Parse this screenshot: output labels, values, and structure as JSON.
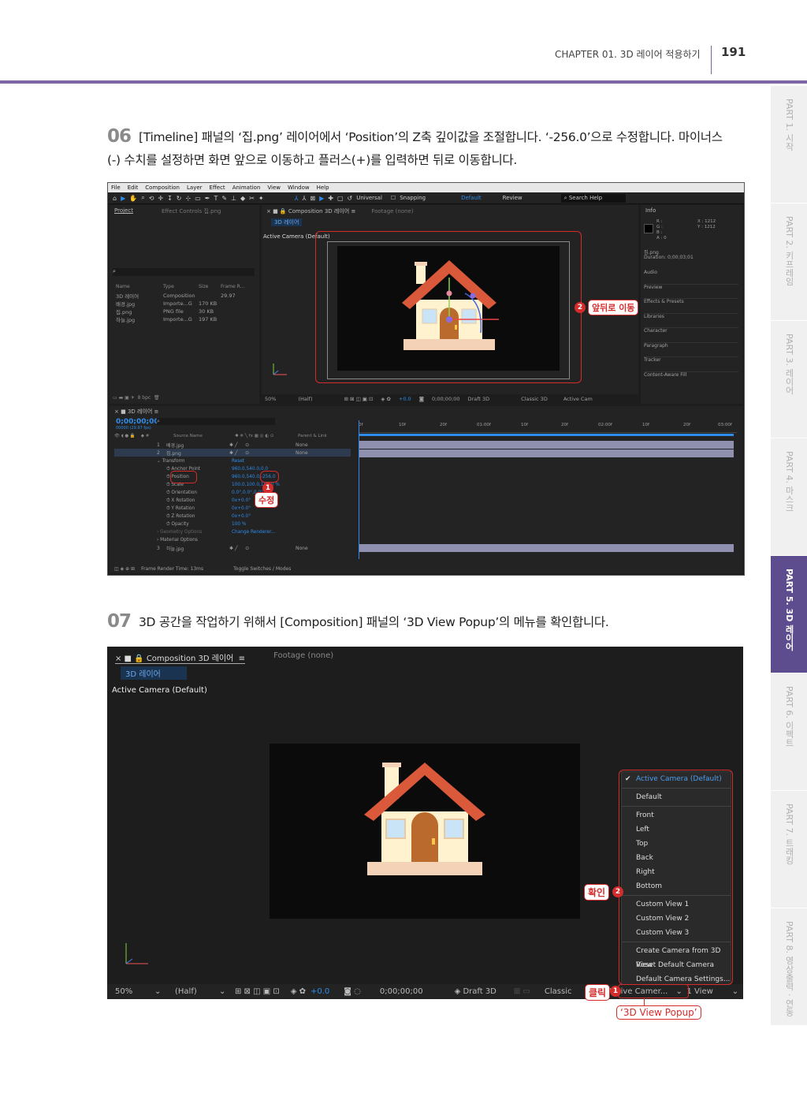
{
  "header": {
    "chapter": "CHAPTER 01. 3D 레이어 적용하기",
    "page_number": "191"
  },
  "side_tabs": [
    {
      "label": "PART 1. 시작",
      "active": false
    },
    {
      "label": "PART 2. 키프레임",
      "active": false
    },
    {
      "label": "PART 3. 레이어",
      "active": false
    },
    {
      "label": "PART 4. 마스크",
      "active": false
    },
    {
      "label": "PART 5. 3D 레이어",
      "active": true
    },
    {
      "label": "PART 6. 이펙트",
      "active": false
    },
    {
      "label": "PART 7. 트래킹",
      "active": false
    },
    {
      "label": "PART 8. 영상출력 · 연동",
      "active": false
    }
  ],
  "step06": {
    "number": "06",
    "line1": "[Timeline] 패널의 ‘집.png’ 레이어에서 ‘Position’의 Z축 깊이값을 조절합니다. ‘-256.0’으로 수정합니다. 마이너스",
    "line2": "(-) 수치를 설정하면 화면 앞으로 이동하고 플러스(+)를 입력하면 뒤로 이동합니다."
  },
  "step07": {
    "number": "07",
    "line1": "3D 공간을 작업하기 위해서 [Composition] 패널의 ‘3D View Popup’의 메뉴를 확인합니다."
  },
  "ae1": {
    "menu": [
      "File",
      "Edit",
      "Composition",
      "Layer",
      "Effect",
      "Animation",
      "View",
      "Window",
      "Help"
    ],
    "toolbar_right": {
      "universal": "Universal",
      "snapping": "Snapping",
      "default": "Default",
      "review": "Review",
      "search": "Search Help"
    },
    "project_tab": "Project",
    "effect_controls_tab": "Effect Controls 집.png",
    "project_columns": [
      "Name",
      "Type",
      "Size",
      "Frame R..."
    ],
    "project_items": [
      {
        "name": "3D 레이어",
        "type": "Composition",
        "size": "",
        "fps": "29.97"
      },
      {
        "name": "배경.jpg",
        "type": "Importe...G",
        "size": "170 KB",
        "fps": ""
      },
      {
        "name": "집.png",
        "type": "PNG file",
        "size": "30 KB",
        "fps": ""
      },
      {
        "name": "하늘.jpg",
        "type": "Importe...G",
        "size": "197 KB",
        "fps": ""
      }
    ],
    "project_footer": "8 bpc",
    "comp_tab": "Composition 3D 레이어",
    "footage_tab": "Footage (none)",
    "comp_subtab": "3D 레이어",
    "active_camera": "Active Camera (Default)",
    "comp_footer": {
      "zoom": "50%",
      "res": "(Half)",
      "exposure": "+0.0",
      "time": "0;00;00;00",
      "draft": "Draft 3D",
      "renderer": "Classic 3D",
      "view": "Active Cam"
    },
    "info_tab": "Info",
    "info_rgb": [
      "R :",
      "G :",
      "B :",
      "A : 0"
    ],
    "info_xy": [
      "X : 1212",
      "Y : 1212"
    ],
    "info_file": "집.png",
    "info_duration": "Duration: 0;00;03;01",
    "right_panels": [
      "Audio",
      "Preview",
      "Effects & Presets",
      "Libraries",
      "Character",
      "Paragraph",
      "Tracker",
      "Content-Aware Fill"
    ],
    "timeline_tab": "3D 레이어",
    "timecode": "0;00;00;00",
    "timecode_sub": "00000 (29.97 fps)",
    "tl_columns": {
      "source": "Source Name",
      "parent": "Parent & Link"
    },
    "ruler": [
      "0f",
      "10f",
      "20f",
      "01:00f",
      "10f",
      "20f",
      "02:00f",
      "10f",
      "20f",
      "03:00f"
    ],
    "layers": [
      {
        "num": "1",
        "name": "배경.jpg",
        "parent": "None"
      },
      {
        "num": "2",
        "name": "집.png",
        "parent": "None"
      },
      {
        "num": "3",
        "name": "하늘.jpg",
        "parent": "None"
      }
    ],
    "props": [
      {
        "name": "Transform",
        "value": "Reset"
      },
      {
        "name": "Anchor Point",
        "value": "960.0,540.0,0.0"
      },
      {
        "name": "Position",
        "value": "960.0,540.0,-256.0"
      },
      {
        "name": "Scale",
        "value": "100.0,100.0,100.0 %"
      },
      {
        "name": "Orientation",
        "value": "0.0°,0.0°,0.0°"
      },
      {
        "name": "X Rotation",
        "value": "0x+0.0°"
      },
      {
        "name": "Y Rotation",
        "value": "0x+0.0°"
      },
      {
        "name": "Z Rotation",
        "value": "0x+0.0°"
      },
      {
        "name": "Opacity",
        "value": "100 %"
      },
      {
        "name": "Geometry Options",
        "value": "Change Renderer..."
      },
      {
        "name": "Material Options",
        "value": ""
      }
    ],
    "footer_left": "Frame Render Time: 13ms",
    "footer_mid": "Toggle Switches / Modes",
    "callout_move": "앞뒤로 이동",
    "callout_edit": "수정",
    "badge1": "1",
    "badge2": "2"
  },
  "ae2": {
    "comp_tab": "Composition 3D 레이어",
    "footage_tab": "Footage (none)",
    "subtab": "3D 레이어",
    "active_camera": "Active Camera (Default)",
    "menu_selected": "Active Camera (Default)",
    "menu_groups": [
      [
        "Default"
      ],
      [
        "Front",
        "Left",
        "Top",
        "Back",
        "Right",
        "Bottom"
      ],
      [
        "Custom View 1",
        "Custom View 2",
        "Custom View 3"
      ],
      [
        "Create Camera from 3D View",
        "Reset Default Camera",
        "Default Camera Settings..."
      ]
    ],
    "footer": {
      "zoom": "50%",
      "res": "(Half)",
      "exposure": "+0.0",
      "time": "0;00;00;00",
      "draft": "Draft 3D",
      "renderer": "Classic",
      "view": "Active Camer...",
      "views": "1 View"
    },
    "callout_confirm": "확인",
    "callout_click": "클릭",
    "callout_popup": "‘3D View Popup’",
    "badge1": "1",
    "badge2": "2"
  },
  "colors": {
    "accent_purple": "#7d66a8",
    "callout_red": "#d42b2b",
    "ae_blue": "#2d8ceb"
  }
}
